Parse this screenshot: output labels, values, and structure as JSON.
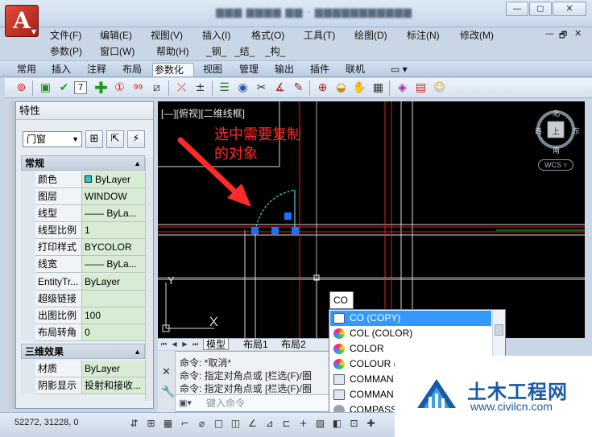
{
  "app": {
    "title_blurred": "▆▆▆ ▆▆▆▆ ▆▆ · ▆▆▆▆▆▆▆▆▆▆▆",
    "logo": "A",
    "window_buttons": [
      "—",
      "◻",
      "✕"
    ],
    "mdi_controls": [
      "—",
      "🗗",
      "✕"
    ]
  },
  "menu_row1": [
    "文件(F)",
    "编辑(E)",
    "视图(V)",
    "插入(I)",
    "格式(O)",
    "工具(T)",
    "绘图(D)",
    "标注(N)",
    "修改(M)"
  ],
  "menu_row2": [
    "参数(P)",
    "窗口(W)",
    "帮助(H)",
    "_钢_",
    "_结_",
    "_构_"
  ],
  "ribbon_tabs": [
    "常用",
    "插入",
    "注释",
    "布局",
    "参数化",
    "视图",
    "管理",
    "输出",
    "插件",
    "联机"
  ],
  "ribbon_active": "参数化",
  "ribbon_extra": "▭ ▾",
  "toolbar_icons": [
    "gear-target",
    "rect-green",
    "check",
    "seven",
    "plus-green",
    "one-circle",
    "ninety-nine",
    "ruler",
    "sep",
    "line-x",
    "plus-minus",
    "sep",
    "list-lines",
    "eye",
    "scissors",
    "angle",
    "pencil-list",
    "sep",
    "zoom-in",
    "coin",
    "hand",
    "sep",
    "block-x",
    "book",
    "smiley"
  ],
  "properties": {
    "title": "特性",
    "selected_type": "门窗",
    "section_general": "常规",
    "general_rows": [
      {
        "key": "颜色",
        "value": "ByLayer",
        "swatch": "#2ec4c4"
      },
      {
        "key": "图层",
        "value": "WINDOW"
      },
      {
        "key": "线型",
        "value": "—— ByLa..."
      },
      {
        "key": "线型比例",
        "value": "1"
      },
      {
        "key": "打印样式",
        "value": "BYCOLOR"
      },
      {
        "key": "线宽",
        "value": "—— ByLa..."
      },
      {
        "key": "EntityTr...",
        "value": "ByLayer"
      },
      {
        "key": "超级链接",
        "value": ""
      },
      {
        "key": "出图比例",
        "value": "100"
      },
      {
        "key": "布局转角",
        "value": "0"
      }
    ],
    "section_3d": "三维效果",
    "three_d_rows": [
      {
        "key": "材质",
        "value": "ByLayer"
      },
      {
        "key": "阴影显示",
        "value": "投射和接收..."
      }
    ]
  },
  "viewport": {
    "label": "[—][俯视][二维线框]",
    "annotation_line1": "选中需要复制",
    "annotation_line2": "的对象",
    "compass": {
      "n": "北",
      "s": "南",
      "e": "东",
      "w": "西",
      "top": "上"
    },
    "wcs": "WCS ▿",
    "ucs_y": "Y",
    "ucs_x": "X"
  },
  "layout_tabs": [
    "模型",
    "布局1",
    "布局2"
  ],
  "command": {
    "history": [
      "命令: *取消*",
      "命令: 指定对角点或 [栏选(F)/圈",
      "命令: 指定对角点或 [栏选(F)/圈"
    ],
    "placeholder": "键入命令",
    "prompt_icon": "▣▾",
    "typed": "CO"
  },
  "autocomplete": [
    {
      "label": "CO (COPY)",
      "selected": true,
      "icon": "copy"
    },
    {
      "label": "COL (COLOR)",
      "selected": false,
      "icon": "color-wheel"
    },
    {
      "label": "COLOR",
      "selected": false,
      "icon": "color-wheel"
    },
    {
      "label": "COLOUR (C",
      "selected": false,
      "icon": "color-wheel"
    },
    {
      "label": "COMMAN",
      "selected": false,
      "icon": "window"
    },
    {
      "label": "COMMAN",
      "selected": false,
      "icon": "window"
    },
    {
      "label": "COMPASS",
      "selected": false,
      "icon": "gear"
    }
  ],
  "status": {
    "coords": "52272, 31228, 0"
  },
  "watermark": {
    "cn": "土木工程网",
    "url": "www.civilcn.com"
  },
  "colors": {
    "accent_red": "#ff2a2a",
    "grip_blue": "#1e6fff",
    "selection_blue": "#3399ff",
    "prop_value_bg": "#d8ebd5"
  }
}
